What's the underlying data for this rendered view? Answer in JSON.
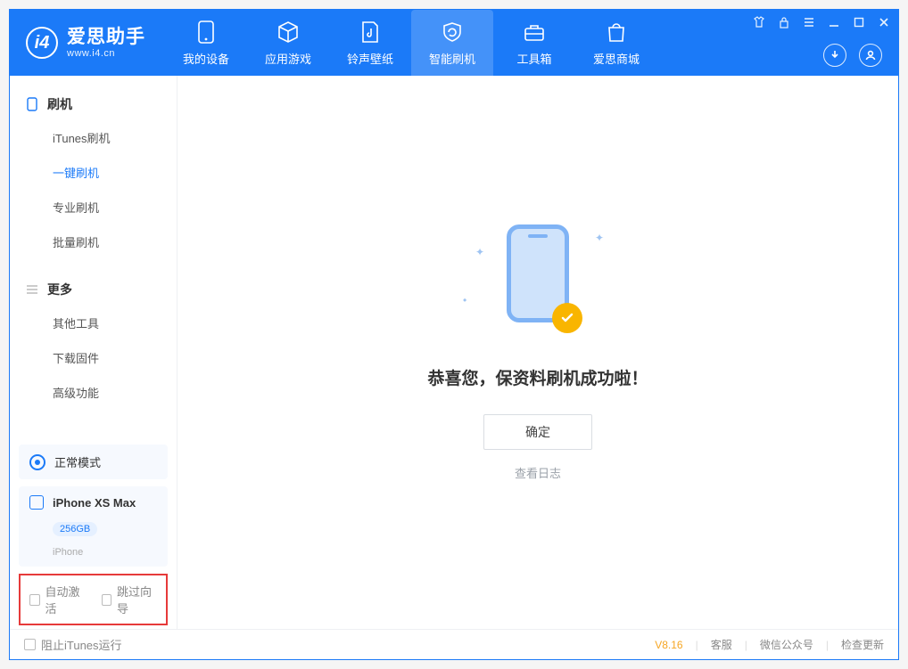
{
  "app": {
    "name": "爱思助手",
    "url": "www.i4.cn"
  },
  "nav": {
    "items": [
      {
        "label": "我的设备"
      },
      {
        "label": "应用游戏"
      },
      {
        "label": "铃声壁纸"
      },
      {
        "label": "智能刷机"
      },
      {
        "label": "工具箱"
      },
      {
        "label": "爱思商城"
      }
    ],
    "active_index": 3
  },
  "sidebar": {
    "group1": {
      "title": "刷机",
      "items": [
        "iTunes刷机",
        "一键刷机",
        "专业刷机",
        "批量刷机"
      ],
      "active_index": 1
    },
    "group2": {
      "title": "更多",
      "items": [
        "其他工具",
        "下载固件",
        "高级功能"
      ]
    },
    "mode": {
      "label": "正常模式"
    },
    "device": {
      "name": "iPhone XS Max",
      "capacity": "256GB",
      "type": "iPhone"
    },
    "checkboxes": {
      "auto_activate": "自动激活",
      "skip_guide": "跳过向导"
    }
  },
  "main": {
    "message": "恭喜您，保资料刷机成功啦！",
    "ok": "确定",
    "view_log": "查看日志"
  },
  "footer": {
    "block_itunes": "阻止iTunes运行",
    "version": "V8.16",
    "links": [
      "客服",
      "微信公众号",
      "检查更新"
    ]
  }
}
